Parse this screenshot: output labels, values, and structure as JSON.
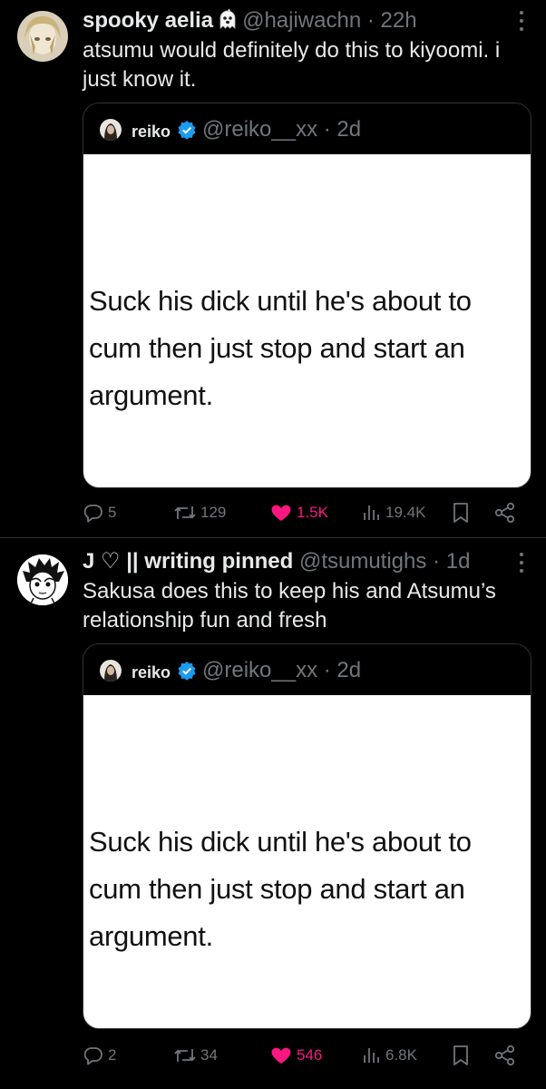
{
  "tweets": [
    {
      "name": "spooky aelia",
      "handle": "@hajiwachn",
      "time": "22h",
      "text": "atsumu would definitely do this to kiyoomi. i just know it.",
      "quote": {
        "name": "reiko",
        "handle": "@reiko__xx",
        "time": "2d",
        "image_text": "Suck his dick until he's about to cum then just stop and start an argument."
      },
      "actions": {
        "replies": "5",
        "reposts": "129",
        "likes": "1.5K",
        "views": "19.4K"
      }
    },
    {
      "name": "J ♡ || writing pinned",
      "handle": "@tsumutighs",
      "time": "1d",
      "text": "Sakusa does this to keep his and Atsumu’s relationship fun and fresh",
      "quote": {
        "name": "reiko",
        "handle": "@reiko__xx",
        "time": "2d",
        "image_text": "Suck his dick until he's about to cum then just stop and start an argument."
      },
      "actions": {
        "replies": "2",
        "reposts": "34",
        "likes": "546",
        "views": "6.8K"
      }
    }
  ],
  "separator": "·",
  "icons": {
    "reply": "speech-bubble-icon",
    "repost": "repost-arrows-icon",
    "like": "heart-icon",
    "views": "bar-chart-icon",
    "bookmark": "bookmark-icon",
    "share": "share-icon",
    "more": "three-dots-vertical-icon",
    "verified": "verified-badge-icon",
    "ghost": "ghost-emoji-icon"
  },
  "colors": {
    "background": "#000000",
    "text": "#e7e9ea",
    "muted": "#71767b",
    "like": "#f91880",
    "verified": "#1d9bf0",
    "border": "#2f3336"
  }
}
